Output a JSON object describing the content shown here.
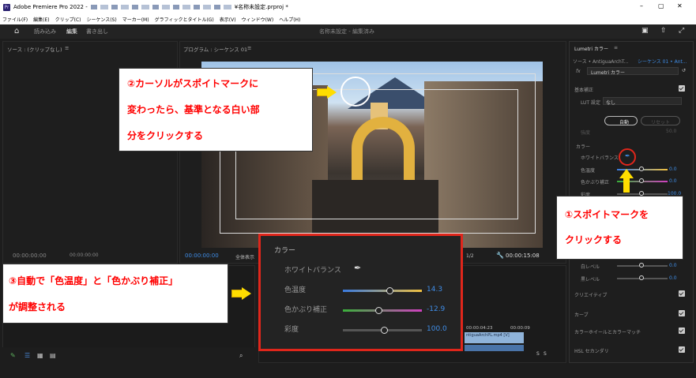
{
  "window": {
    "app_icon": "Pr",
    "title_prefix": "Adobe Premiere Pro 2022 - ",
    "title_suffix": "¥名称未設定.prproj *",
    "minimize": "–",
    "restore": "▢",
    "close": "✕"
  },
  "menu": [
    "ファイル(F)",
    "編集(E)",
    "クリップ(C)",
    "シーケンス(S)",
    "マーカー(M)",
    "グラフィックとタイトル(G)",
    "表示(V)",
    "ウィンドウ(W)",
    "ヘルプ(H)"
  ],
  "workspace": {
    "import": "読み込み",
    "edit": "編集",
    "export": "書き出し",
    "project_status": "名称未設定 - 編集済み"
  },
  "source": {
    "title": "ソース : (クリップなし)",
    "menu": "≡",
    "timecode": "00:00:00:00",
    "timecode2": "00:00:00:00"
  },
  "program": {
    "title": "プログラム : シーケンス 01",
    "menu": "≡",
    "timecode": "00:00:00:00",
    "fit": "全体表示",
    "fraction": "1/2",
    "duration": "00:00:15:08"
  },
  "timeline": {
    "time1": "00:00:04:23",
    "time2": "00:00:09",
    "clip": "ntiguaArchPL.mp4 [V]",
    "meter_s1": "S",
    "meter_s2": "S"
  },
  "lumetri": {
    "panel_title": "Lumetri カラー",
    "panel_menu": "≡",
    "source_tab": "ソース • AntiguaArchT...",
    "seq_tab": "シーケンス 01 • Ant...",
    "fx": "fx",
    "effect_name": "Lumetri カラー",
    "basic": "基本補正",
    "lut_label": "LUT 設定",
    "lut_value": "なし",
    "auto": "自動",
    "reset": "リセット",
    "intensity": "強度",
    "intensity_value": "50.0",
    "color_section": "カラー",
    "wb": "ホワイトバランス",
    "temp": "色温度",
    "temp_value": "0.0",
    "tint": "色かぶり補正",
    "tint_value": "0.0",
    "sat": "彩度",
    "sat_value": "100.0",
    "whites": "白レベル",
    "whites_value": "0.0",
    "blacks": "黒レベル",
    "blacks_value": "0.0",
    "creative": "クリエイティブ",
    "curves": "カーブ",
    "wheels": "カラーホイールとカラーマッチ",
    "hsl": "HSL セカンダリ"
  },
  "popup": {
    "section": "カラー",
    "wb": "ホワイトバランス",
    "temp": "色温度",
    "temp_value": "14.3",
    "tint": "色かぶり補正",
    "tint_value": "-12.9",
    "sat": "彩度",
    "sat_value": "100.0"
  },
  "callouts": {
    "c1_line1": "①スポイトマークを",
    "c1_line2": "クリックする",
    "c2_line1": "②カーソルがスポイトマークに",
    "c2_line2": "変わったら、基準となる白い部",
    "c2_line3": "分をクリックする",
    "c3_line1": "③自動で「色温度」と「色かぶり補正」",
    "c3_line2": "が調整される"
  },
  "colors": {
    "accent_blue": "#3f8de7",
    "annotation_red": "#e0261b",
    "annotation_yellow": "#ffdd00"
  }
}
